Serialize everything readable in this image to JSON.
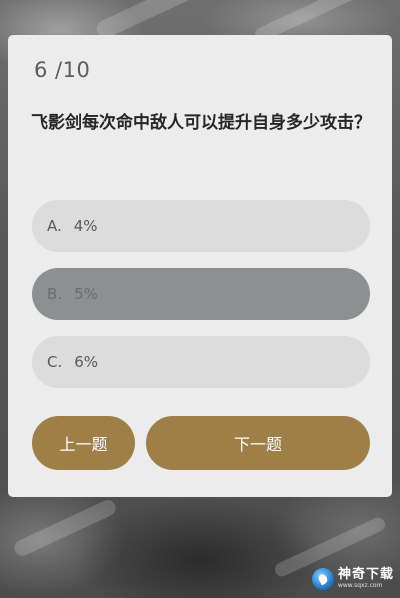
{
  "quiz": {
    "progress": "6 /10",
    "question": "飞影剑每次命中敌人可以提升自身多少攻击？"
  },
  "options": [
    {
      "letter": "A.",
      "text": "4%",
      "selected": false
    },
    {
      "letter": "B.",
      "text": "5%",
      "selected": true
    },
    {
      "letter": "C.",
      "text": "6%",
      "selected": false
    }
  ],
  "buttons": {
    "prev_label": "上一题",
    "next_label": "下一题"
  },
  "watermark": {
    "name": "神奇下载",
    "url": "www.sqxz.com"
  },
  "colors": {
    "card_bg": "#ececec",
    "option_bg": "#dcdcdc",
    "option_selected_bg": "#8d9090",
    "button_bg": "#9d7f47"
  }
}
